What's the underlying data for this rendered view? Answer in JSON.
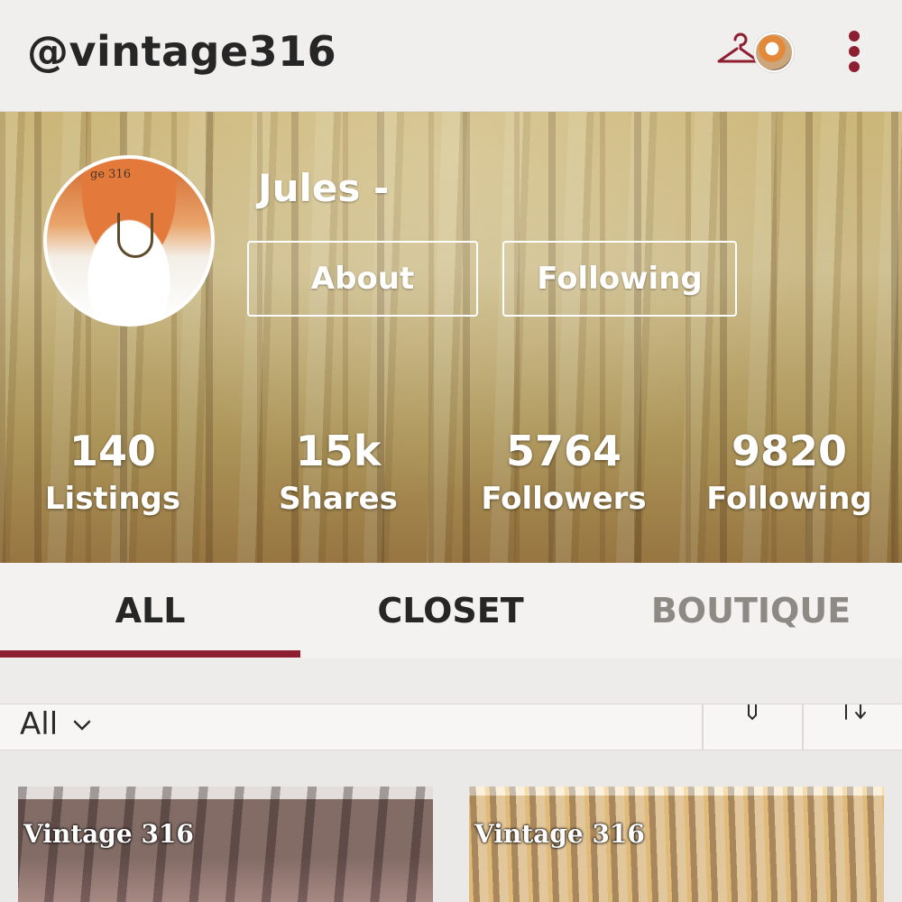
{
  "header": {
    "handle": "@vintage316",
    "icons": [
      "hanger-icon",
      "avatar",
      "kebab-menu-icon"
    ],
    "accent_color": "#8e1f31"
  },
  "profile": {
    "name": "Jules -",
    "picture_watermark": "ge 316",
    "buttons": {
      "about": "About",
      "following": "Following"
    },
    "stats": [
      {
        "value": "140",
        "label": "Listings"
      },
      {
        "value": "15k",
        "label": "Shares"
      },
      {
        "value": "5764",
        "label": "Followers"
      },
      {
        "value": "9820",
        "label": "Following"
      }
    ]
  },
  "tabs": [
    {
      "label": "ALL",
      "selected": true
    },
    {
      "label": "CLOSET",
      "selected": false
    },
    {
      "label": "BOUTIQUE",
      "selected": false
    }
  ],
  "filter": {
    "selected": "All",
    "icons": [
      "chevron-down-icon",
      "filter-icon",
      "sort-icon"
    ]
  },
  "listings": [
    {
      "watermark": "Vintage 316"
    },
    {
      "watermark": "Vintage 316"
    }
  ]
}
